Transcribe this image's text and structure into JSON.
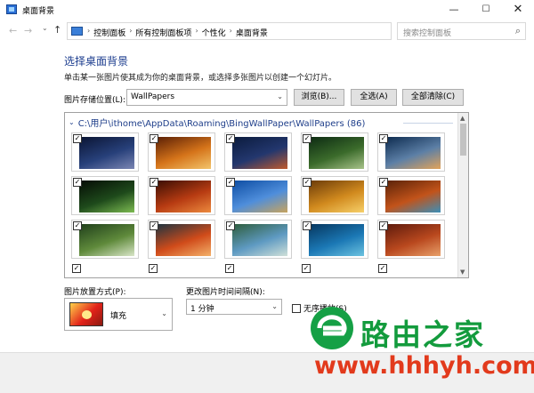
{
  "window": {
    "title": "桌面背景"
  },
  "controls": {
    "minimize": "—",
    "maximize": "☐",
    "close": "✕"
  },
  "nav": {
    "back": "←",
    "forward": "→",
    "recent": "⌄",
    "up": "↑"
  },
  "breadcrumb": [
    "控制面板",
    "所有控制面板项",
    "个性化",
    "桌面背景"
  ],
  "breadcrumb_sep": "›",
  "search": {
    "placeholder": "搜索控制面板"
  },
  "header": {
    "title": "选择桌面背景",
    "description": "单击某一张图片使其成为你的桌面背景，或选择多张图片以创建一个幻灯片。"
  },
  "location": {
    "label": "图片存储位置(L):",
    "value": "WallPapers",
    "browse": "浏览(B)...",
    "select_all": "全选(A)",
    "clear_all": "全部清除(C)"
  },
  "gallery": {
    "folder": "C:\\用户\\ithome\\AppData\\Roaming\\BingWallPaper\\WallPapers (86)",
    "check": "✓",
    "images": [
      {
        "name": "satellite-dishes",
        "colors": [
          "#0a1433",
          "#27407a",
          "#7b86b3"
        ]
      },
      {
        "name": "canyon-sunset",
        "colors": [
          "#5a1f05",
          "#d5741a",
          "#f2c46b"
        ]
      },
      {
        "name": "night-trees",
        "colors": [
          "#0b1b3d",
          "#23376e",
          "#c05a2e"
        ]
      },
      {
        "name": "forest-stream",
        "colors": [
          "#0c2a12",
          "#3b6b2b",
          "#a8c38a"
        ]
      },
      {
        "name": "coast-dusk",
        "colors": [
          "#0d2b4f",
          "#5c7fa6",
          "#e2a35a"
        ]
      },
      {
        "name": "green-bird",
        "colors": [
          "#050c05",
          "#1e4a1b",
          "#7dbb52"
        ]
      },
      {
        "name": "red-dunes",
        "colors": [
          "#3a0e04",
          "#b73b12",
          "#ec8a3e"
        ]
      },
      {
        "name": "palace-sky",
        "colors": [
          "#0d4da3",
          "#4f8edb",
          "#c7a35d"
        ]
      },
      {
        "name": "salt-pans",
        "colors": [
          "#6b3b09",
          "#d18a1e",
          "#f6d06a"
        ]
      },
      {
        "name": "river-canyon",
        "colors": [
          "#5a2208",
          "#c2531a",
          "#3b8fb8"
        ]
      },
      {
        "name": "white-bird",
        "colors": [
          "#1f3f1b",
          "#5f8a3b",
          "#d9e6c8"
        ]
      },
      {
        "name": "koi-fish",
        "colors": [
          "#1c3340",
          "#d04b1a",
          "#f3b16a"
        ]
      },
      {
        "name": "river-aerial",
        "colors": [
          "#2e5d3c",
          "#5e9ac2",
          "#cfe0d8"
        ]
      },
      {
        "name": "reef-diver",
        "colors": [
          "#06365e",
          "#1b78b5",
          "#6cc3e0"
        ]
      },
      {
        "name": "canyon-layers",
        "colors": [
          "#5d1a0c",
          "#b9481e",
          "#e8a06a"
        ]
      }
    ]
  },
  "picture_position": {
    "label": "图片放置方式(P):",
    "value": "填充",
    "arrow": "⌄"
  },
  "interval": {
    "label": "更改图片时间间隔(N):",
    "value": "1 分钟",
    "arrow": "⌄"
  },
  "shuffle": {
    "label": "无序播放(S)"
  },
  "watermark": {
    "brand": "路由之家",
    "url": "www.hhhyh.com"
  }
}
